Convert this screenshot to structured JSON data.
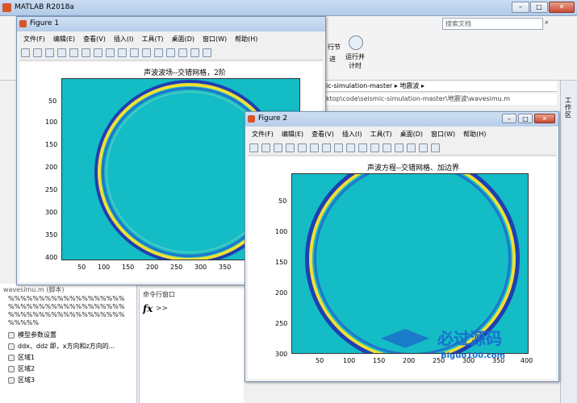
{
  "matlab": {
    "title": "MATLAB R2018a",
    "search_placeholder": "搜索文档",
    "ribbon_run_section": "运行并\n计时",
    "ribbon_run_label": "行节",
    "ribbon_run_label2": "进",
    "address_path": "ic-simulation-master ▸ 地震波 ▸",
    "file_path": "ktop\\code\\seismic-simulation-master\\地震波\\wavesimu.m",
    "work_pane_label": "工作区",
    "editor_header": "wavesimu.m (脚本)",
    "code_comment": "%%%%%%%%%%%%%%%%%%%%%%%%%%%%%%%%%%%%%%%%%%%%%%%%%%%%%%%%%%%%%%",
    "tree_items": [
      "模型参数设置",
      "ddx、ddz 即，x方向和z方向的...",
      "区域1",
      "区域2",
      "区域3"
    ],
    "cmd_header": "命令行窗口",
    "cmd_fx": "fx",
    "cmd_prompt": ">>"
  },
  "figure1": {
    "title": "Figure 1",
    "menu": [
      "文件(F)",
      "编辑(E)",
      "查看(V)",
      "插入(I)",
      "工具(T)",
      "桌面(D)",
      "窗口(W)",
      "帮助(H)"
    ],
    "plot_title": "声波波场--交错网格，2阶",
    "yticks": [
      "50",
      "100",
      "150",
      "200",
      "250",
      "300",
      "350",
      "400"
    ],
    "xticks": [
      "50",
      "100",
      "150",
      "200",
      "250",
      "300",
      "350",
      "4"
    ]
  },
  "figure2": {
    "title": "Figure 2",
    "menu": [
      "文件(F)",
      "编辑(E)",
      "查看(V)",
      "插入(I)",
      "工具(T)",
      "桌面(D)",
      "窗口(W)",
      "帮助(H)"
    ],
    "plot_title": "声波方程--交错网格、加边界",
    "yticks": [
      "50",
      "100",
      "150",
      "200",
      "250",
      "300"
    ],
    "xticks": [
      "50",
      "100",
      "150",
      "200",
      "250",
      "300",
      "350",
      "400"
    ]
  },
  "watermark": {
    "main": "必过源码",
    "sub": "Biguo100.com"
  },
  "colors": {
    "field": "#14bcc6",
    "wave_yellow": "#f2e033",
    "wave_blue": "#1f3fb3"
  }
}
